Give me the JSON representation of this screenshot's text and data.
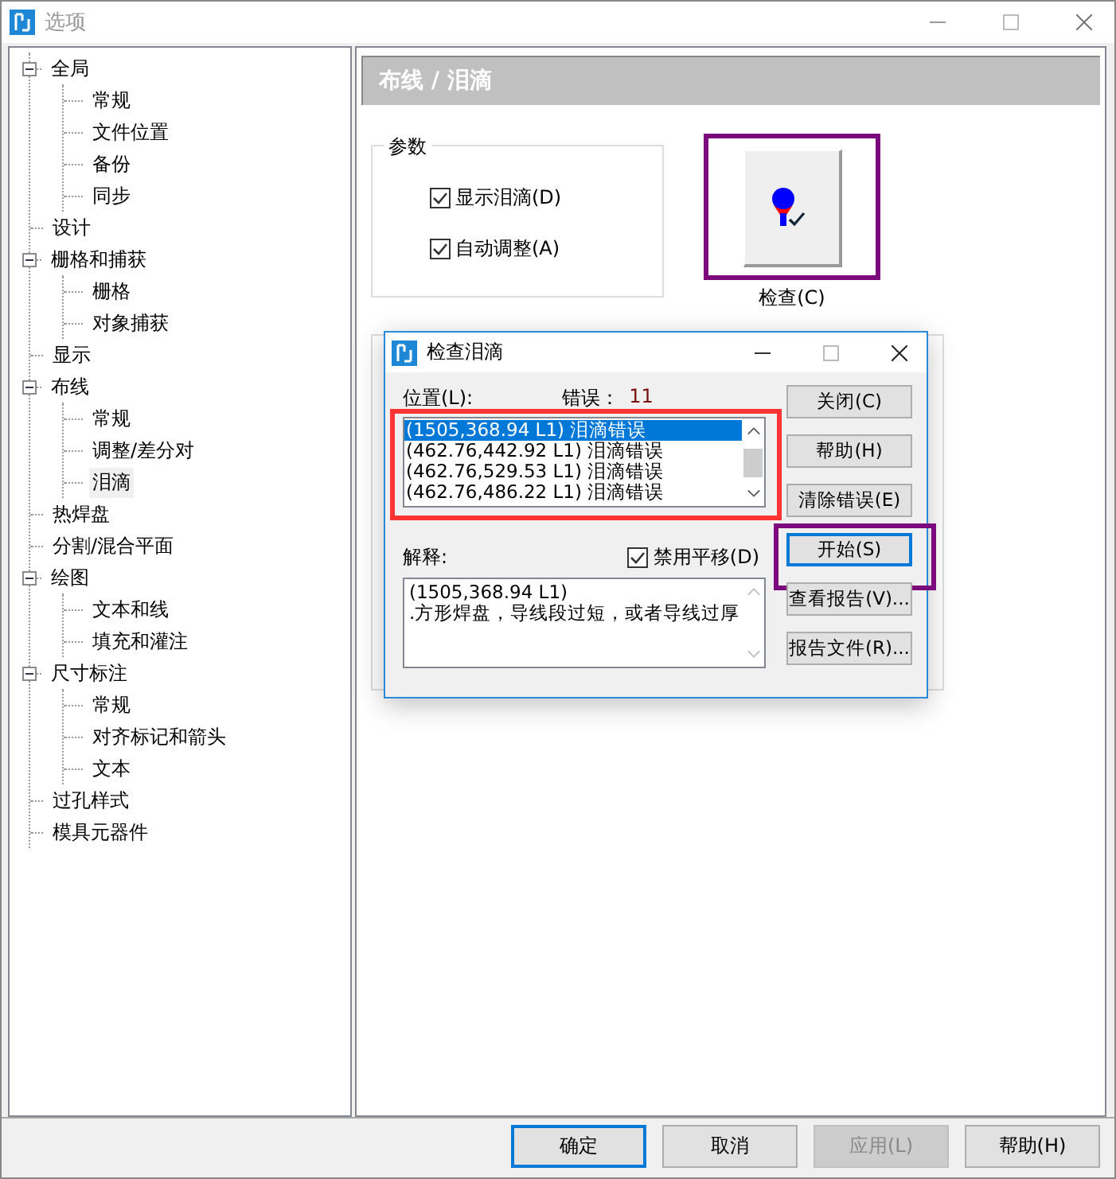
{
  "window": {
    "title": "选项"
  },
  "tree": [
    {
      "label": "全局",
      "expanded": true,
      "selected": false,
      "children": [
        {
          "label": "常规",
          "selected": false
        },
        {
          "label": "文件位置",
          "selected": false
        },
        {
          "label": "备份",
          "selected": false
        },
        {
          "label": "同步",
          "selected": false
        }
      ]
    },
    {
      "label": "设计",
      "selected": false
    },
    {
      "label": "栅格和捕获",
      "expanded": true,
      "selected": false,
      "children": [
        {
          "label": "栅格",
          "selected": false
        },
        {
          "label": "对象捕获",
          "selected": false
        }
      ]
    },
    {
      "label": "显示",
      "selected": false
    },
    {
      "label": "布线",
      "expanded": true,
      "selected": false,
      "children": [
        {
          "label": "常规",
          "selected": false
        },
        {
          "label": "调整/差分对",
          "selected": false
        },
        {
          "label": "泪滴",
          "selected": true
        }
      ]
    },
    {
      "label": "热焊盘",
      "selected": false
    },
    {
      "label": "分割/混合平面",
      "selected": false
    },
    {
      "label": "绘图",
      "expanded": true,
      "selected": false,
      "children": [
        {
          "label": "文本和线",
          "selected": false
        },
        {
          "label": "填充和灌注",
          "selected": false
        }
      ]
    },
    {
      "label": "尺寸标注",
      "expanded": true,
      "selected": false,
      "children": [
        {
          "label": "常规",
          "selected": false
        },
        {
          "label": "对齐标记和箭头",
          "selected": false
        },
        {
          "label": "文本",
          "selected": false
        }
      ]
    },
    {
      "label": "过孔样式",
      "selected": false
    },
    {
      "label": "模具元器件",
      "selected": false
    }
  ],
  "page": {
    "header": "布线 / 泪滴",
    "group": {
      "title": "参数",
      "options": [
        {
          "label": "显示泪滴(D)",
          "checked": true
        },
        {
          "label": "自动调整(A)",
          "checked": true
        }
      ]
    },
    "check_button": {
      "label": "检查(C)",
      "annotated": true
    }
  },
  "dialog": {
    "title": "检查泪滴",
    "position_label": "位置(L):",
    "errors_label": "错误：",
    "errors_count": "11",
    "list_annotated": true,
    "rows": [
      {
        "text": "(1505,368.94 L1) 泪滴错误",
        "selected": true
      },
      {
        "text": "(462.76,442.92 L1) 泪滴错误",
        "selected": false
      },
      {
        "text": "(462.76,529.53 L1) 泪滴错误",
        "selected": false
      },
      {
        "text": "(462.76,486.22 L1) 泪滴错误",
        "selected": false
      }
    ],
    "explain_label": "解释:",
    "disable_pan": {
      "label": "禁用平移(D)",
      "checked": true
    },
    "explanation": [
      "(1505,368.94 L1)",
      ".方形焊盘，导线段过短，或者导线过厚"
    ],
    "buttons": [
      {
        "label": "关闭(C)",
        "focused": false,
        "annotated": false
      },
      {
        "label": "帮助(H)",
        "focused": false,
        "annotated": false
      },
      {
        "label": "清除错误(E)",
        "focused": false,
        "annotated": false
      },
      {
        "label": "开始(S)",
        "focused": true,
        "annotated": true
      },
      {
        "label": "查看报告(V)...",
        "focused": false,
        "annotated": false
      },
      {
        "label": "报告文件(R)...",
        "focused": false,
        "annotated": false
      }
    ]
  },
  "footer_buttons": [
    {
      "label": "确定",
      "focused": true,
      "disabled": false
    },
    {
      "label": "取消",
      "focused": false,
      "disabled": false
    },
    {
      "label": "应用(L)",
      "focused": false,
      "disabled": true
    },
    {
      "label": "帮助(H)",
      "focused": false,
      "disabled": false
    }
  ]
}
